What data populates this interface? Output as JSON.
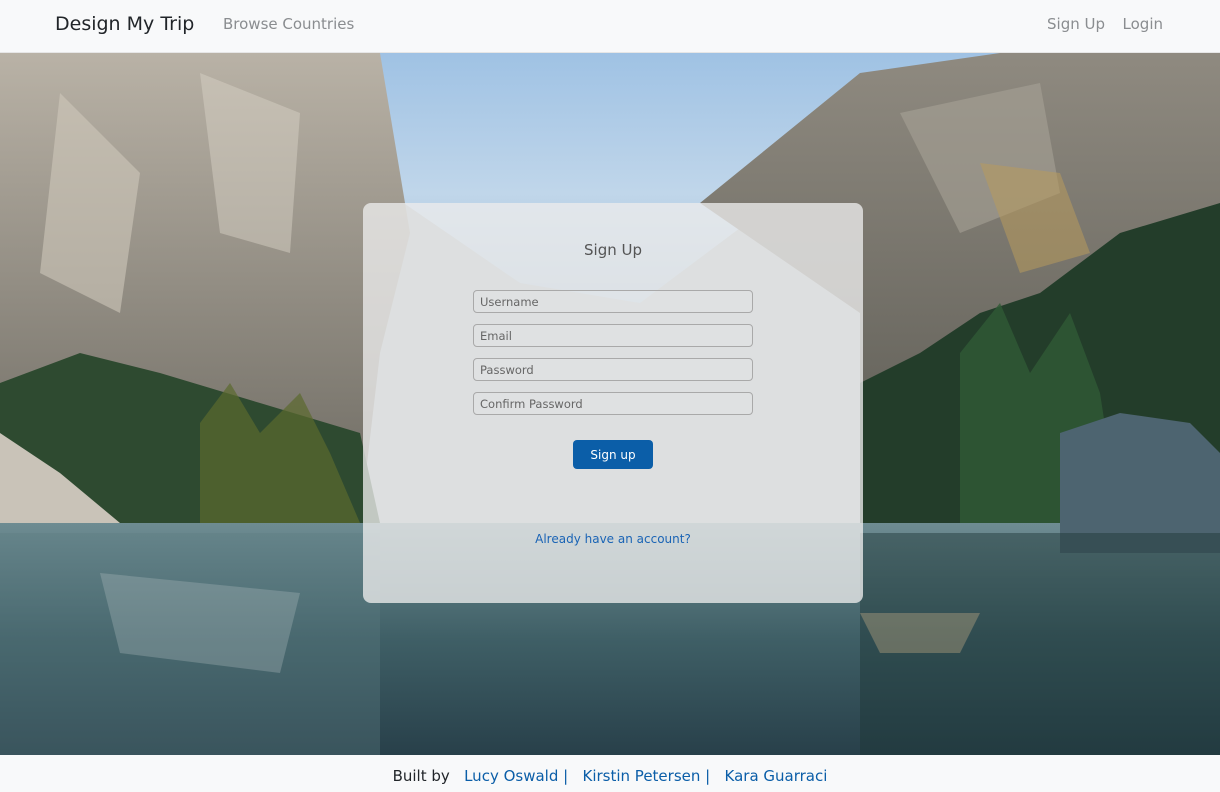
{
  "navbar": {
    "brand": "Design My Trip",
    "browse_label": "Browse Countries",
    "signup_label": "Sign Up",
    "login_label": "Login"
  },
  "form": {
    "title": "Sign Up",
    "username_placeholder": "Username",
    "email_placeholder": "Email",
    "password_placeholder": "Password",
    "confirm_placeholder": "Confirm Password",
    "submit_label": "Sign up",
    "login_link": "Already have an account?"
  },
  "footer": {
    "prefix": "Built by",
    "authors": [
      "Lucy Oswald |",
      "Kirstin Petersen |",
      "Kara Guarraci"
    ]
  },
  "colors": {
    "button": "#0b5ea8",
    "link": "#1a64b5"
  }
}
